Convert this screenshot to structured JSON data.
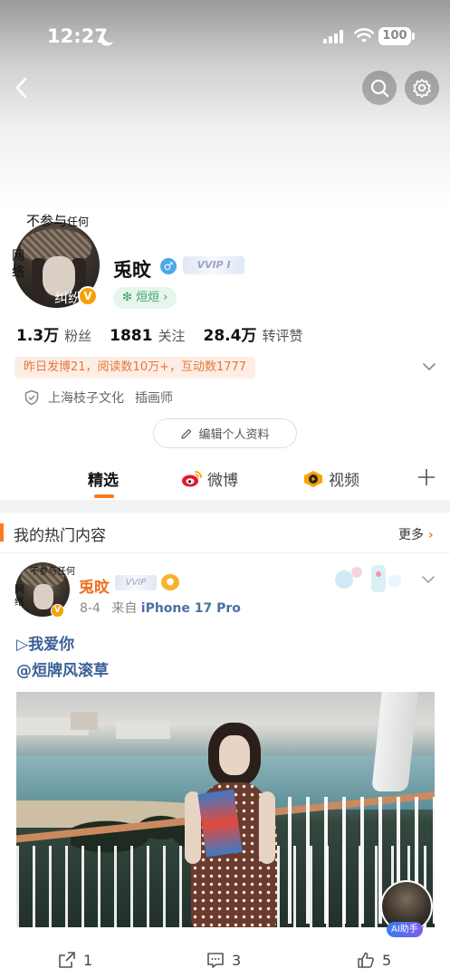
{
  "status_bar": {
    "time": "12:27",
    "battery": "100"
  },
  "profile": {
    "avatar_overlay": {
      "line1": "不参与",
      "line1_small": "任何",
      "side1": "网",
      "side2": "络",
      "bottom": "纠纷"
    },
    "v_badge": "V",
    "name": "兎旼",
    "gender_symbol": "♂",
    "vip_text": "VVIP I",
    "fan_tag": "❇ 烜烜 ›",
    "stats": [
      {
        "num": "1.3万",
        "label": "粉丝"
      },
      {
        "num": "1881",
        "label": "关注"
      },
      {
        "num": "28.4万",
        "label": "转评赞"
      }
    ],
    "activity": "昨日发博21，阅读数10万+，互动数1777",
    "company": "上海枝子文化",
    "job": "插画师",
    "edit_button": "编辑个人资料"
  },
  "tabs": [
    {
      "label": "精选",
      "active": true
    },
    {
      "label": "微博",
      "active": false
    },
    {
      "label": "视频",
      "active": false
    }
  ],
  "hot_section": {
    "title": "我的热门内容",
    "more": "更多"
  },
  "post": {
    "avatar_overlay": {
      "top": "不参与任何",
      "side1": "网",
      "side2": "络"
    },
    "v_badge": "V",
    "name": "兎旼",
    "vip_text": "VVIP",
    "meta_date": "8-4",
    "meta_from": "来自",
    "meta_device": "iPhone 17 Pro",
    "line1": "▷我爱你",
    "line2": "@烜牌风滚草",
    "ai_label": "AI助手"
  },
  "actions": {
    "repost": "1",
    "comment": "3",
    "like": "5"
  },
  "colors": {
    "accent": "#ff7a1a",
    "link": "#3b5f96",
    "green_tag": "#3ca36a",
    "activity": "#e8753b"
  }
}
